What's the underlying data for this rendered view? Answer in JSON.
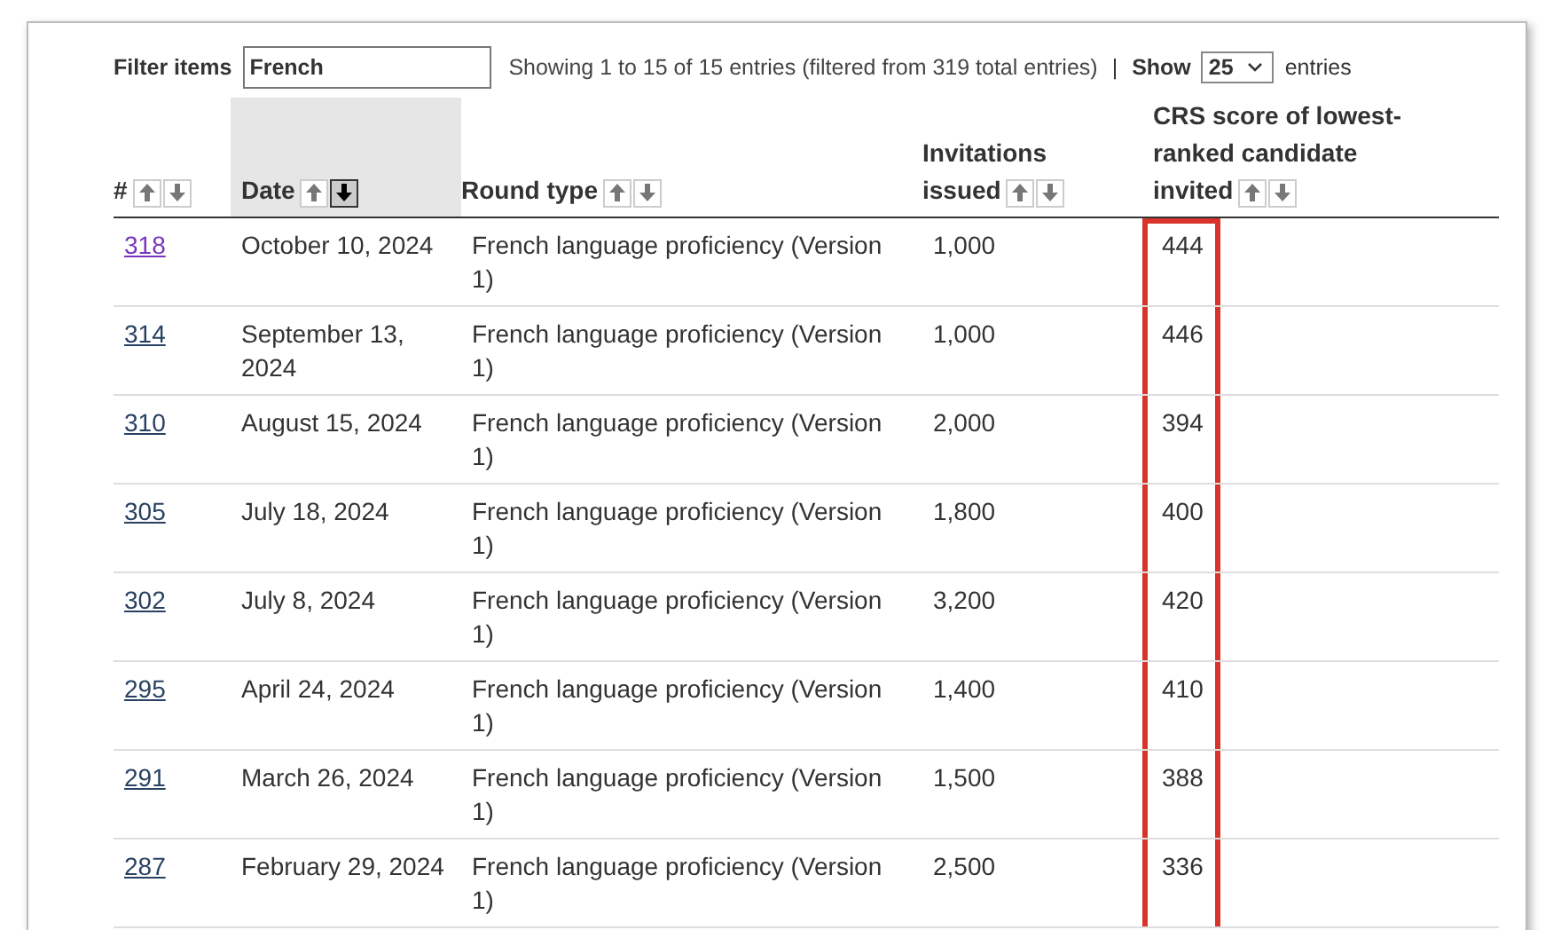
{
  "filter": {
    "label": "Filter items",
    "value": "French"
  },
  "info": "Showing 1 to 15 of 15 entries (filtered from 319 total entries)",
  "separator": "|",
  "length": {
    "label_before": "Show",
    "value": "25",
    "label_after": "entries"
  },
  "table": {
    "columns": [
      {
        "label": "#",
        "sorted_descending": false
      },
      {
        "label": "Date",
        "sorted_descending": true
      },
      {
        "label": "Round type",
        "sorted_descending": false
      },
      {
        "label": "Invitations issued",
        "sorted_descending": false
      },
      {
        "label": "CRS score of lowest-ranked candidate invited",
        "sorted_descending": false
      }
    ],
    "crs_column_outlined": true,
    "rows": [
      {
        "number": "318",
        "visited": true,
        "date": "October 10, 2024",
        "round_type": "French language proficiency (Version 1)",
        "invitations": "1,000",
        "crs": "444"
      },
      {
        "number": "314",
        "visited": false,
        "date": "September 13, 2024",
        "round_type": "French language proficiency (Version 1)",
        "invitations": "1,000",
        "crs": "446"
      },
      {
        "number": "310",
        "visited": false,
        "date": "August 15, 2024",
        "round_type": "French language proficiency (Version 1)",
        "invitations": "2,000",
        "crs": "394"
      },
      {
        "number": "305",
        "visited": false,
        "date": "July 18, 2024",
        "round_type": "French language proficiency (Version 1)",
        "invitations": "1,800",
        "crs": "400"
      },
      {
        "number": "302",
        "visited": false,
        "date": "July 8, 2024",
        "round_type": "French language proficiency (Version 1)",
        "invitations": "3,200",
        "crs": "420"
      },
      {
        "number": "295",
        "visited": false,
        "date": "April 24, 2024",
        "round_type": "French language proficiency (Version 1)",
        "invitations": "1,400",
        "crs": "410"
      },
      {
        "number": "291",
        "visited": false,
        "date": "March 26, 2024",
        "round_type": "French language proficiency (Version 1)",
        "invitations": "1,500",
        "crs": "388"
      },
      {
        "number": "287",
        "visited": false,
        "date": "February 29, 2024",
        "round_type": "French language proficiency (Version 1)",
        "invitations": "2,500",
        "crs": "336"
      }
    ]
  }
}
